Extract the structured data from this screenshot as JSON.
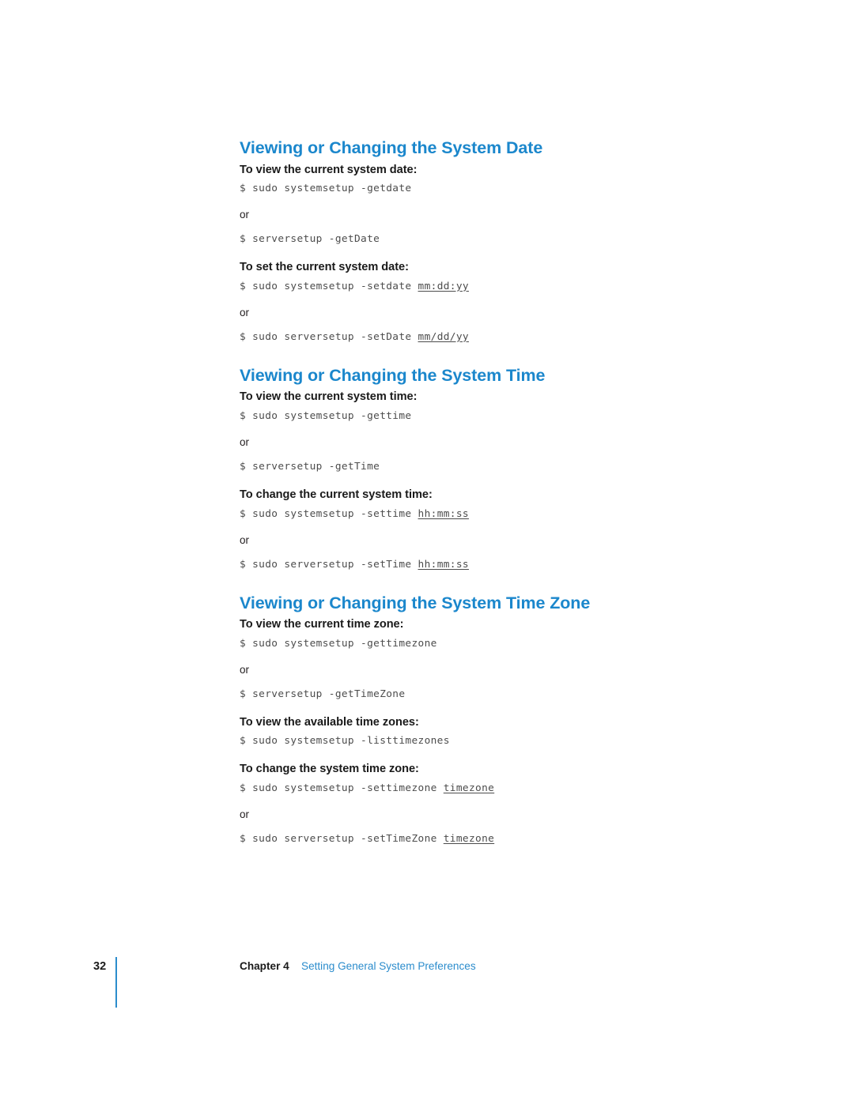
{
  "page": {
    "number": "32",
    "background": "#ffffff",
    "heading_color": "#1b87cc",
    "body_color": "#1a1a1a",
    "code_color": "#4c4c4c"
  },
  "footer": {
    "page_number": "32",
    "chapter_label": "Chapter 4",
    "chapter_title": "Setting General System Preferences",
    "rule_color": "#2b8ccc"
  },
  "sections": [
    {
      "heading": "Viewing or Changing the System Date",
      "blocks": [
        {
          "task": "To view the current system date:",
          "lines": [
            {
              "kind": "code",
              "prefix": "$ sudo systemsetup -getdate",
              "arg": ""
            },
            {
              "kind": "or",
              "text": "or"
            },
            {
              "kind": "code",
              "prefix": "$ serversetup -getDate",
              "arg": ""
            }
          ]
        },
        {
          "task": "To set the current system date:",
          "lines": [
            {
              "kind": "code",
              "prefix": "$ sudo systemsetup -setdate ",
              "arg": "mm:dd:yy"
            },
            {
              "kind": "or",
              "text": "or"
            },
            {
              "kind": "code",
              "prefix": "$ sudo serversetup -setDate ",
              "arg": "mm/dd/yy"
            }
          ]
        }
      ]
    },
    {
      "heading": "Viewing or Changing the System Time",
      "blocks": [
        {
          "task": "To view the current system time:",
          "lines": [
            {
              "kind": "code",
              "prefix": "$ sudo systemsetup -gettime",
              "arg": ""
            },
            {
              "kind": "or",
              "text": "or"
            },
            {
              "kind": "code",
              "prefix": "$ serversetup -getTime",
              "arg": ""
            }
          ]
        },
        {
          "task": "To change the current system time:",
          "lines": [
            {
              "kind": "code",
              "prefix": "$ sudo systemsetup -settime ",
              "arg": "hh:mm:ss"
            },
            {
              "kind": "or",
              "text": "or"
            },
            {
              "kind": "code",
              "prefix": "$ sudo serversetup -setTime ",
              "arg": "hh:mm:ss"
            }
          ]
        }
      ]
    },
    {
      "heading": "Viewing or Changing the System Time Zone",
      "blocks": [
        {
          "task": "To view the current time zone:",
          "lines": [
            {
              "kind": "code",
              "prefix": "$ sudo systemsetup -gettimezone",
              "arg": ""
            },
            {
              "kind": "or",
              "text": "or"
            },
            {
              "kind": "code",
              "prefix": "$ serversetup -getTimeZone",
              "arg": ""
            }
          ]
        },
        {
          "task": "To view the available time zones:",
          "lines": [
            {
              "kind": "code",
              "prefix": "$ sudo systemsetup -listtimezones",
              "arg": ""
            }
          ]
        },
        {
          "task": "To change the system time zone:",
          "lines": [
            {
              "kind": "code",
              "prefix": "$ sudo systemsetup -settimezone ",
              "arg": "timezone"
            },
            {
              "kind": "or",
              "text": "or"
            },
            {
              "kind": "code",
              "prefix": "$ sudo serversetup -setTimeZone ",
              "arg": "timezone"
            }
          ]
        }
      ]
    }
  ]
}
